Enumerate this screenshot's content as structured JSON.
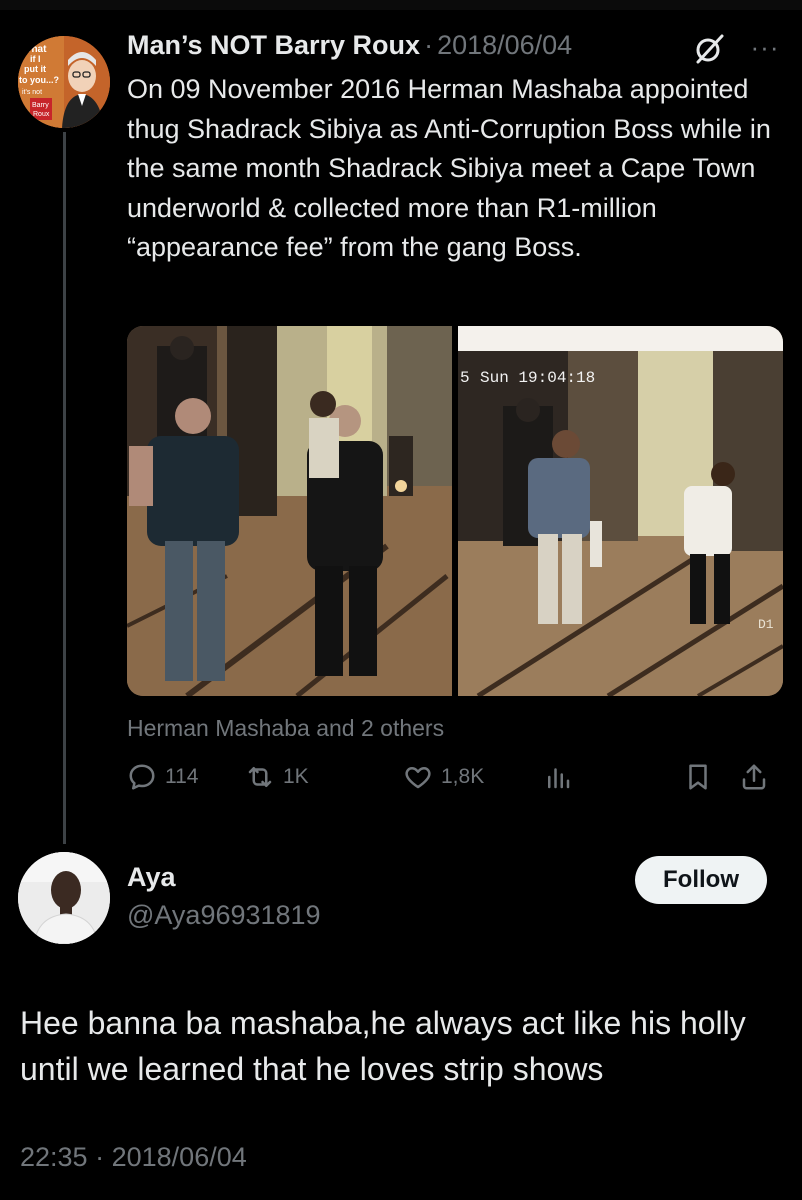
{
  "original_tweet": {
    "author_name": "Man’s NOT Barry Roux",
    "separator": "·",
    "date": "2018/06/04",
    "more_label": "···",
    "avatar_text": [
      "What",
      "if I",
      "put it",
      "to you...?",
      "it's not",
      "Barry",
      "Roux"
    ],
    "text": "On 09 November 2016 Herman Mashaba appointed thug Shadrack Sibiya as Anti-Corruption Boss while in the same month Shadrack Sibiya meet a Cape Town underworld & collected more than R1-million “appearance fee” from the gang Boss.",
    "photo_overlay_text": "Sun 19:04:18",
    "photo_overlay_prefix": "5",
    "photo_corner_label": "D1",
    "tagged": "Herman Mashaba and 2 others",
    "stats": {
      "replies": "114",
      "reposts": "1K",
      "likes": "1,8K"
    }
  },
  "reply": {
    "author_name": "Aya",
    "handle": "@Aya96931819",
    "follow_label": "Follow",
    "text": "Hee banna ba mashaba,he always act like his holly until we learned that he loves strip shows",
    "time": "22:35",
    "separator": "·",
    "date": "2018/06/04"
  },
  "colors": {
    "background": "#000000",
    "text_primary": "#e7e9ea",
    "text_secondary": "#71767b",
    "follow_bg": "#eff3f4",
    "thread_line": "#3d4246"
  }
}
